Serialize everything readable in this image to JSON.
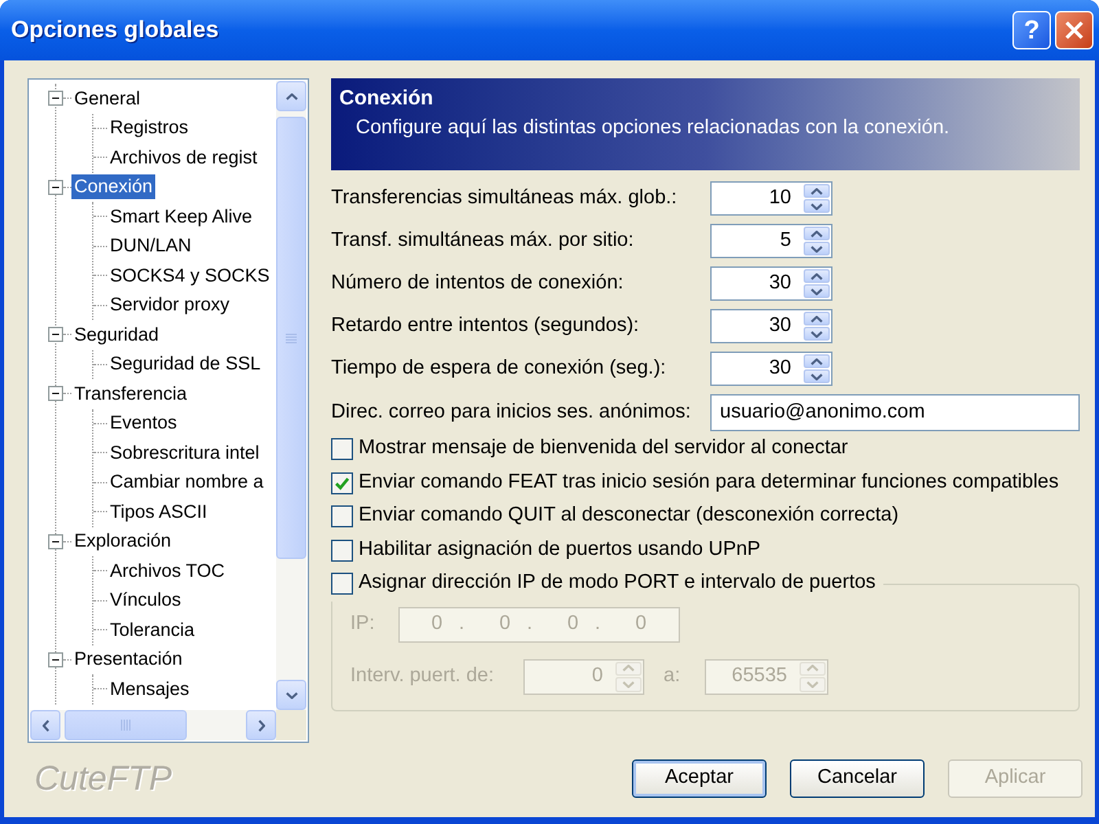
{
  "window": {
    "title": "Opciones globales",
    "help_label": "?"
  },
  "tree": [
    {
      "label": "General",
      "expanded": true,
      "selected": false,
      "children": [
        {
          "label": "Registros",
          "selected": false
        },
        {
          "label": "Archivos de regist",
          "selected": false
        }
      ]
    },
    {
      "label": "Conexión",
      "expanded": true,
      "selected": true,
      "children": [
        {
          "label": "Smart Keep Alive",
          "selected": false
        },
        {
          "label": "DUN/LAN",
          "selected": false
        },
        {
          "label": "SOCKS4 y SOCKS",
          "selected": false
        },
        {
          "label": "Servidor proxy",
          "selected": false
        }
      ]
    },
    {
      "label": "Seguridad",
      "expanded": true,
      "selected": false,
      "children": [
        {
          "label": "Seguridad de SSL",
          "selected": false
        }
      ]
    },
    {
      "label": "Transferencia",
      "expanded": true,
      "selected": false,
      "children": [
        {
          "label": "Eventos",
          "selected": false
        },
        {
          "label": "Sobrescritura intel",
          "selected": false
        },
        {
          "label": "Cambiar nombre a",
          "selected": false
        },
        {
          "label": "Tipos ASCII",
          "selected": false
        }
      ]
    },
    {
      "label": "Exploración",
      "expanded": true,
      "selected": false,
      "children": [
        {
          "label": "Archivos TOC",
          "selected": false
        },
        {
          "label": "Vínculos",
          "selected": false
        },
        {
          "label": "Tolerancia",
          "selected": false
        }
      ]
    },
    {
      "label": "Presentación",
      "expanded": true,
      "selected": false,
      "children": [
        {
          "label": "Mensajes",
          "selected": false
        }
      ]
    }
  ],
  "brand": "CuteFTP",
  "header": {
    "title": "Conexión",
    "description": "Configure aquí las distintas opciones relacionadas con la conexión."
  },
  "spin_fields": [
    {
      "label": "Transferencias simultáneas máx. glob.:",
      "value": "10"
    },
    {
      "label": "Transf. simultáneas máx. por sitio:",
      "value": "5"
    },
    {
      "label": "Número de intentos de conexión:",
      "value": "30"
    },
    {
      "label": "Retardo entre intentos (segundos):",
      "value": "30"
    },
    {
      "label": "Tiempo de espera de conexión (seg.):",
      "value": "30"
    }
  ],
  "email_field": {
    "label": "Direc. correo para inicios ses. anónimos:",
    "value": "usuario@anonimo.com"
  },
  "checkboxes": [
    {
      "label": "Mostrar mensaje de bienvenida del servidor al conectar",
      "checked": false
    },
    {
      "label": "Enviar comando FEAT tras inicio sesión para determinar funciones compatibles",
      "checked": true
    },
    {
      "label": "Enviar comando QUIT al desconectar (desconexión correcta)",
      "checked": false
    },
    {
      "label": "Habilitar asignación de puertos usando UPnP",
      "checked": false
    }
  ],
  "port_range": {
    "label": "Asignar dirección IP de modo PORT e intervalo de puertos",
    "checked": false,
    "ip": {
      "label": "IP:",
      "octets": [
        "0",
        "0",
        "0",
        "0"
      ],
      "separators": [
        ".",
        ".",
        "."
      ],
      "disabled": true
    },
    "from": {
      "label": "Interv. puert. de:",
      "value": "0",
      "disabled": true
    },
    "to": {
      "label": "a:",
      "value": "65535",
      "disabled": true
    }
  },
  "buttons": [
    {
      "label": "Aceptar",
      "default": true,
      "disabled": false
    },
    {
      "label": "Cancelar",
      "default": false,
      "disabled": false
    },
    {
      "label": "Aplicar",
      "default": false,
      "disabled": true
    }
  ]
}
